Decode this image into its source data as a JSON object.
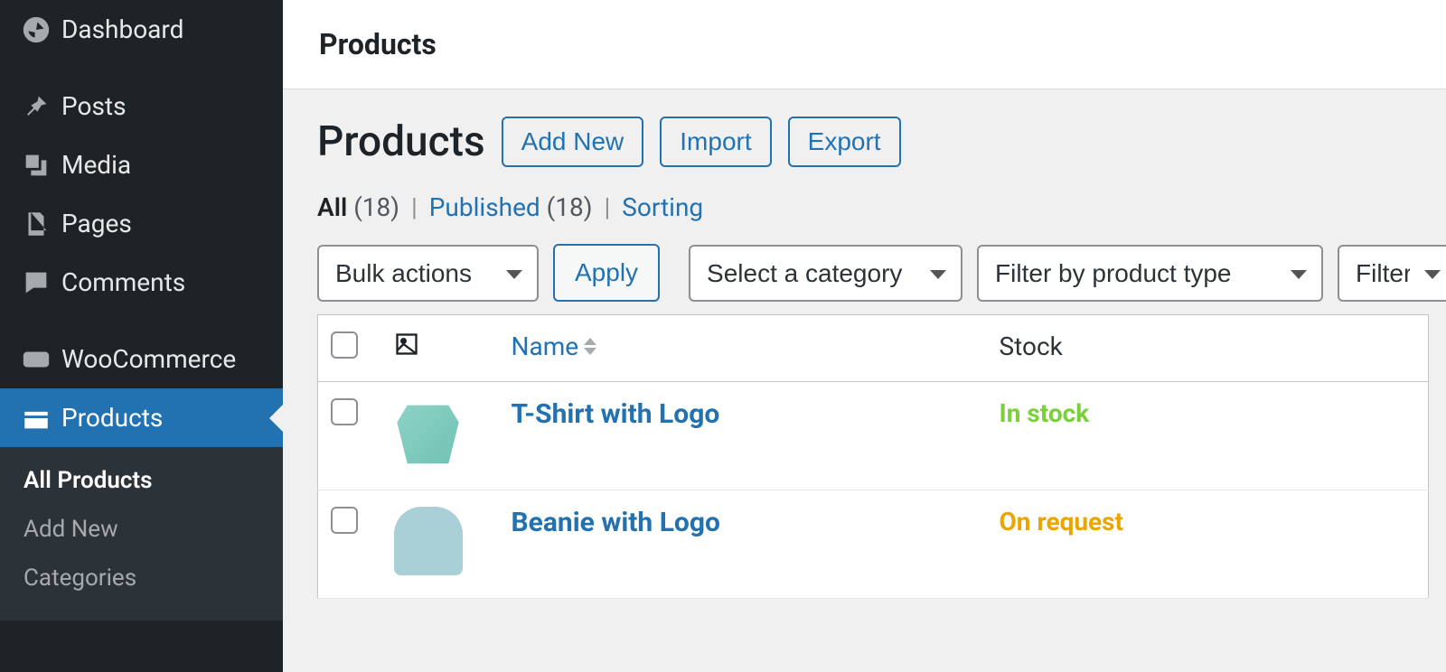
{
  "sidebar": {
    "items": [
      {
        "label": "Dashboard"
      },
      {
        "label": "Posts"
      },
      {
        "label": "Media"
      },
      {
        "label": "Pages"
      },
      {
        "label": "Comments"
      },
      {
        "label": "WooCommerce"
      },
      {
        "label": "Products"
      }
    ],
    "submenu": [
      {
        "label": "All Products"
      },
      {
        "label": "Add New"
      },
      {
        "label": "Categories"
      }
    ]
  },
  "topbar": {
    "title": "Products"
  },
  "header": {
    "title": "Products",
    "add_new": "Add New",
    "import": "Import",
    "export": "Export"
  },
  "subsub": {
    "all_label": "All",
    "all_count": "(18)",
    "published_label": "Published",
    "published_count": "(18)",
    "sorting_label": "Sorting",
    "sep": "|"
  },
  "filters": {
    "bulk": "Bulk actions",
    "apply": "Apply",
    "category": "Select a category",
    "product_type": "Filter by product type",
    "stock": "Filter b"
  },
  "table": {
    "headers": {
      "name": "Name",
      "stock": "Stock"
    },
    "rows": [
      {
        "name": "T-Shirt with Logo",
        "stock": "In stock",
        "stock_class": "stock-instock"
      },
      {
        "name": "Beanie with Logo",
        "stock": "On request",
        "stock_class": "stock-onrequest"
      }
    ]
  }
}
